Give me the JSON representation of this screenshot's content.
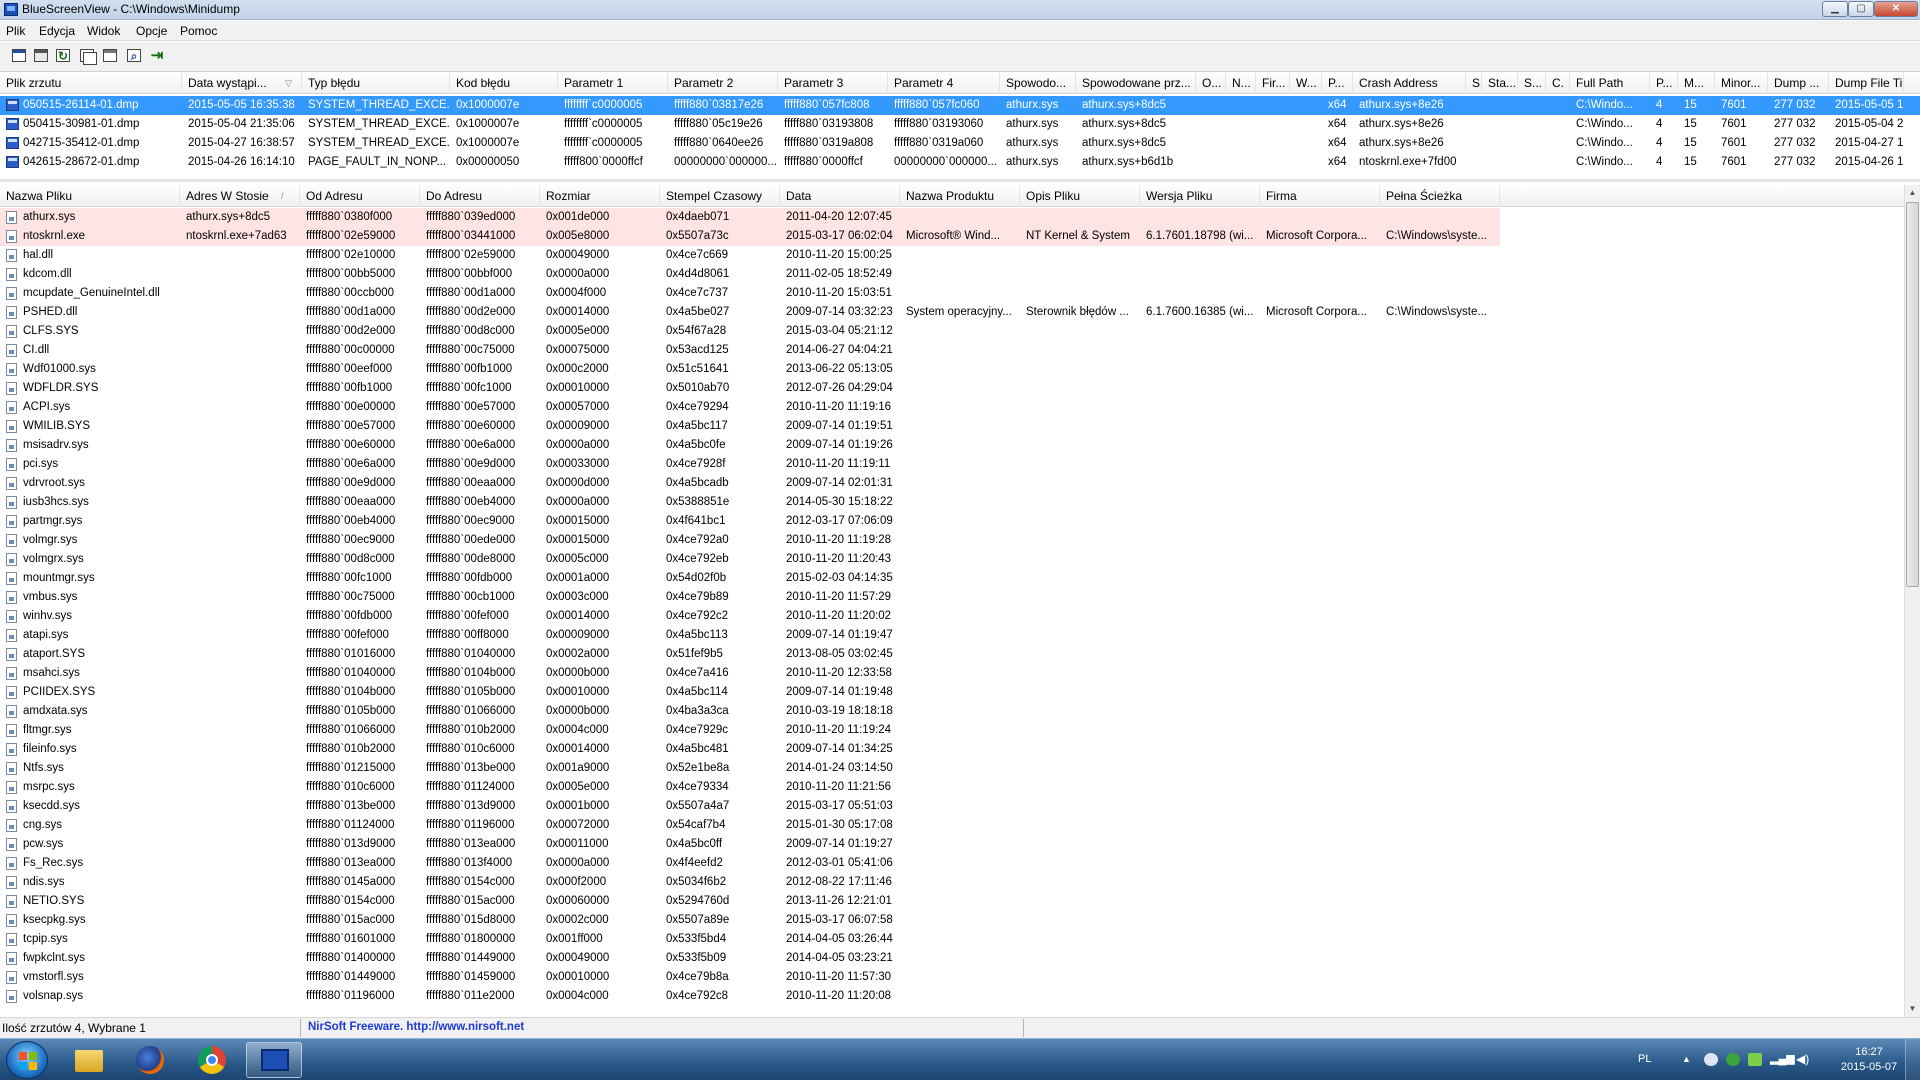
{
  "window": {
    "title": "BlueScreenView - C:\\Windows\\Minidump",
    "min_symbol": "▁",
    "max_symbol": "▢",
    "close_symbol": "✕"
  },
  "menu": [
    "Plik",
    "Edycja",
    "Widok",
    "Opcje",
    "Pomoc"
  ],
  "toolbar_icons": [
    "properties-icon",
    "save-icon",
    "refresh-icon",
    "copy-icon",
    "html-report-icon",
    "find-icon",
    "exit-icon"
  ],
  "top_list": {
    "headers": [
      "Plik zrzutu",
      "Data wystąpi...",
      "Typ błędu",
      "Kod błędu",
      "Parametr 1",
      "Parametr 2",
      "Parametr 3",
      "Parametr 4",
      "Spowodo...",
      "Spowodowane prz...",
      "O...",
      "N...",
      "Fir...",
      "W...",
      "P...",
      "Crash Address",
      "S",
      "Sta...",
      "S...",
      "C.",
      "Full Path",
      "P...",
      "M...",
      "Minor...",
      "Dump ...",
      "Dump File Ti..."
    ],
    "rows": [
      {
        "selected": true,
        "cells": [
          "050515-26114-01.dmp",
          "2015-05-05 16:35:38",
          "SYSTEM_THREAD_EXCE...",
          "0x1000007e",
          "ffffffff`c0000005",
          "fffff880`03817e26",
          "fffff880`057fc808",
          "fffff880`057fc060",
          "athurx.sys",
          "athurx.sys+8dc5",
          "",
          "",
          "",
          "",
          "x64",
          "athurx.sys+8e26",
          "",
          "",
          "",
          "",
          "C:\\Windo...",
          "4",
          "15",
          "7601",
          "277 032",
          "2015-05-05 1..."
        ]
      },
      {
        "selected": false,
        "cells": [
          "050415-30981-01.dmp",
          "2015-05-04 21:35:06",
          "SYSTEM_THREAD_EXCE...",
          "0x1000007e",
          "ffffffff`c0000005",
          "fffff880`05c19e26",
          "fffff880`03193808",
          "fffff880`03193060",
          "athurx.sys",
          "athurx.sys+8dc5",
          "",
          "",
          "",
          "",
          "x64",
          "athurx.sys+8e26",
          "",
          "",
          "",
          "",
          "C:\\Windo...",
          "4",
          "15",
          "7601",
          "277 032",
          "2015-05-04 2..."
        ]
      },
      {
        "selected": false,
        "cells": [
          "042715-35412-01.dmp",
          "2015-04-27 16:38:57",
          "SYSTEM_THREAD_EXCE...",
          "0x1000007e",
          "ffffffff`c0000005",
          "fffff880`0640ee26",
          "fffff880`0319a808",
          "fffff880`0319a060",
          "athurx.sys",
          "athurx.sys+8dc5",
          "",
          "",
          "",
          "",
          "x64",
          "athurx.sys+8e26",
          "",
          "",
          "",
          "",
          "C:\\Windo...",
          "4",
          "15",
          "7601",
          "277 032",
          "2015-04-27 1..."
        ]
      },
      {
        "selected": false,
        "cells": [
          "042615-28672-01.dmp",
          "2015-04-26 16:14:10",
          "PAGE_FAULT_IN_NONP...",
          "0x00000050",
          "fffff800`0000ffcf",
          "00000000`000000...",
          "fffff880`0000ffcf",
          "00000000`000000...",
          "athurx.sys",
          "athurx.sys+b6d1b",
          "",
          "",
          "",
          "",
          "x64",
          "ntoskrnl.exe+7fd00",
          "",
          "",
          "",
          "",
          "C:\\Windo...",
          "4",
          "15",
          "7601",
          "277 032",
          "2015-04-26 1..."
        ]
      }
    ]
  },
  "bottom_list": {
    "headers": [
      "Nazwa Pliku",
      "Adres W Stosie",
      "Od Adresu",
      "Do Adresu",
      "Rozmiar",
      "Stempel Czasowy",
      "Data",
      "Nazwa Produktu",
      "Opis Pliku",
      "Wersja Pliku",
      "Firma",
      "Pełna Ścieżka"
    ],
    "rows": [
      {
        "hl": true,
        "cells": [
          "athurx.sys",
          "athurx.sys+8dc5",
          "fffff880`0380f000",
          "fffff880`039ed000",
          "0x001de000",
          "0x4daeb071",
          "2011-04-20 12:07:45",
          "",
          "",
          "",
          "",
          ""
        ]
      },
      {
        "hl": true,
        "cells": [
          "ntoskrnl.exe",
          "ntoskrnl.exe+7ad63",
          "fffff800`02e59000",
          "fffff800`03441000",
          "0x005e8000",
          "0x5507a73c",
          "2015-03-17 06:02:04",
          "Microsoft® Wind...",
          "NT Kernel & System",
          "6.1.7601.18798 (wi...",
          "Microsoft Corpora...",
          "C:\\Windows\\syste..."
        ]
      },
      {
        "hl": false,
        "cells": [
          "hal.dll",
          "",
          "fffff800`02e10000",
          "fffff800`02e59000",
          "0x00049000",
          "0x4ce7c669",
          "2010-11-20 15:00:25",
          "",
          "",
          "",
          "",
          ""
        ]
      },
      {
        "hl": false,
        "cells": [
          "kdcom.dll",
          "",
          "fffff800`00bb5000",
          "fffff800`00bbf000",
          "0x0000a000",
          "0x4d4d8061",
          "2011-02-05 18:52:49",
          "",
          "",
          "",
          "",
          ""
        ]
      },
      {
        "hl": false,
        "cells": [
          "mcupdate_GenuineIntel.dll",
          "",
          "fffff880`00ccb000",
          "fffff880`00d1a000",
          "0x0004f000",
          "0x4ce7c737",
          "2010-11-20 15:03:51",
          "",
          "",
          "",
          "",
          ""
        ]
      },
      {
        "hl": false,
        "cells": [
          "PSHED.dll",
          "",
          "fffff880`00d1a000",
          "fffff880`00d2e000",
          "0x00014000",
          "0x4a5be027",
          "2009-07-14 03:32:23",
          "System operacyjny...",
          "Sterownik błędów ...",
          "6.1.7600.16385 (wi...",
          "Microsoft Corpora...",
          "C:\\Windows\\syste..."
        ]
      },
      {
        "hl": false,
        "cells": [
          "CLFS.SYS",
          "",
          "fffff880`00d2e000",
          "fffff880`00d8c000",
          "0x0005e000",
          "0x54f67a28",
          "2015-03-04 05:21:12",
          "",
          "",
          "",
          "",
          ""
        ]
      },
      {
        "hl": false,
        "cells": [
          "CI.dll",
          "",
          "fffff880`00c00000",
          "fffff880`00c75000",
          "0x00075000",
          "0x53acd125",
          "2014-06-27 04:04:21",
          "",
          "",
          "",
          "",
          ""
        ]
      },
      {
        "hl": false,
        "cells": [
          "Wdf01000.sys",
          "",
          "fffff880`00eef000",
          "fffff880`00fb1000",
          "0x000c2000",
          "0x51c51641",
          "2013-06-22 05:13:05",
          "",
          "",
          "",
          "",
          ""
        ]
      },
      {
        "hl": false,
        "cells": [
          "WDFLDR.SYS",
          "",
          "fffff880`00fb1000",
          "fffff880`00fc1000",
          "0x00010000",
          "0x5010ab70",
          "2012-07-26 04:29:04",
          "",
          "",
          "",
          "",
          ""
        ]
      },
      {
        "hl": false,
        "cells": [
          "ACPI.sys",
          "",
          "fffff880`00e00000",
          "fffff880`00e57000",
          "0x00057000",
          "0x4ce79294",
          "2010-11-20 11:19:16",
          "",
          "",
          "",
          "",
          ""
        ]
      },
      {
        "hl": false,
        "cells": [
          "WMILIB.SYS",
          "",
          "fffff880`00e57000",
          "fffff880`00e60000",
          "0x00009000",
          "0x4a5bc117",
          "2009-07-14 01:19:51",
          "",
          "",
          "",
          "",
          ""
        ]
      },
      {
        "hl": false,
        "cells": [
          "msisadrv.sys",
          "",
          "fffff880`00e60000",
          "fffff880`00e6a000",
          "0x0000a000",
          "0x4a5bc0fe",
          "2009-07-14 01:19:26",
          "",
          "",
          "",
          "",
          ""
        ]
      },
      {
        "hl": false,
        "cells": [
          "pci.sys",
          "",
          "fffff880`00e6a000",
          "fffff880`00e9d000",
          "0x00033000",
          "0x4ce7928f",
          "2010-11-20 11:19:11",
          "",
          "",
          "",
          "",
          ""
        ]
      },
      {
        "hl": false,
        "cells": [
          "vdrvroot.sys",
          "",
          "fffff880`00e9d000",
          "fffff880`00eaa000",
          "0x0000d000",
          "0x4a5bcadb",
          "2009-07-14 02:01:31",
          "",
          "",
          "",
          "",
          ""
        ]
      },
      {
        "hl": false,
        "cells": [
          "iusb3hcs.sys",
          "",
          "fffff880`00eaa000",
          "fffff880`00eb4000",
          "0x0000a000",
          "0x5388851e",
          "2014-05-30 15:18:22",
          "",
          "",
          "",
          "",
          ""
        ]
      },
      {
        "hl": false,
        "cells": [
          "partmgr.sys",
          "",
          "fffff880`00eb4000",
          "fffff880`00ec9000",
          "0x00015000",
          "0x4f641bc1",
          "2012-03-17 07:06:09",
          "",
          "",
          "",
          "",
          ""
        ]
      },
      {
        "hl": false,
        "cells": [
          "volmgr.sys",
          "",
          "fffff880`00ec9000",
          "fffff880`00ede000",
          "0x00015000",
          "0x4ce792a0",
          "2010-11-20 11:19:28",
          "",
          "",
          "",
          "",
          ""
        ]
      },
      {
        "hl": false,
        "cells": [
          "volmgrx.sys",
          "",
          "fffff880`00d8c000",
          "fffff880`00de8000",
          "0x0005c000",
          "0x4ce792eb",
          "2010-11-20 11:20:43",
          "",
          "",
          "",
          "",
          ""
        ]
      },
      {
        "hl": false,
        "cells": [
          "mountmgr.sys",
          "",
          "fffff880`00fc1000",
          "fffff880`00fdb000",
          "0x0001a000",
          "0x54d02f0b",
          "2015-02-03 04:14:35",
          "",
          "",
          "",
          "",
          ""
        ]
      },
      {
        "hl": false,
        "cells": [
          "vmbus.sys",
          "",
          "fffff880`00c75000",
          "fffff880`00cb1000",
          "0x0003c000",
          "0x4ce79b89",
          "2010-11-20 11:57:29",
          "",
          "",
          "",
          "",
          ""
        ]
      },
      {
        "hl": false,
        "cells": [
          "winhv.sys",
          "",
          "fffff880`00fdb000",
          "fffff880`00fef000",
          "0x00014000",
          "0x4ce792c2",
          "2010-11-20 11:20:02",
          "",
          "",
          "",
          "",
          ""
        ]
      },
      {
        "hl": false,
        "cells": [
          "atapi.sys",
          "",
          "fffff880`00fef000",
          "fffff880`00ff8000",
          "0x00009000",
          "0x4a5bc113",
          "2009-07-14 01:19:47",
          "",
          "",
          "",
          "",
          ""
        ]
      },
      {
        "hl": false,
        "cells": [
          "ataport.SYS",
          "",
          "fffff880`01016000",
          "fffff880`01040000",
          "0x0002a000",
          "0x51fef9b5",
          "2013-08-05 03:02:45",
          "",
          "",
          "",
          "",
          ""
        ]
      },
      {
        "hl": false,
        "cells": [
          "msahci.sys",
          "",
          "fffff880`01040000",
          "fffff880`0104b000",
          "0x0000b000",
          "0x4ce7a416",
          "2010-11-20 12:33:58",
          "",
          "",
          "",
          "",
          ""
        ]
      },
      {
        "hl": false,
        "cells": [
          "PCIIDEX.SYS",
          "",
          "fffff880`0104b000",
          "fffff880`0105b000",
          "0x00010000",
          "0x4a5bc114",
          "2009-07-14 01:19:48",
          "",
          "",
          "",
          "",
          ""
        ]
      },
      {
        "hl": false,
        "cells": [
          "amdxata.sys",
          "",
          "fffff880`0105b000",
          "fffff880`01066000",
          "0x0000b000",
          "0x4ba3a3ca",
          "2010-03-19 18:18:18",
          "",
          "",
          "",
          "",
          ""
        ]
      },
      {
        "hl": false,
        "cells": [
          "fltmgr.sys",
          "",
          "fffff880`01066000",
          "fffff880`010b2000",
          "0x0004c000",
          "0x4ce7929c",
          "2010-11-20 11:19:24",
          "",
          "",
          "",
          "",
          ""
        ]
      },
      {
        "hl": false,
        "cells": [
          "fileinfo.sys",
          "",
          "fffff880`010b2000",
          "fffff880`010c6000",
          "0x00014000",
          "0x4a5bc481",
          "2009-07-14 01:34:25",
          "",
          "",
          "",
          "",
          ""
        ]
      },
      {
        "hl": false,
        "cells": [
          "Ntfs.sys",
          "",
          "fffff880`01215000",
          "fffff880`013be000",
          "0x001a9000",
          "0x52e1be8a",
          "2014-01-24 03:14:50",
          "",
          "",
          "",
          "",
          ""
        ]
      },
      {
        "hl": false,
        "cells": [
          "msrpc.sys",
          "",
          "fffff880`010c6000",
          "fffff880`01124000",
          "0x0005e000",
          "0x4ce79334",
          "2010-11-20 11:21:56",
          "",
          "",
          "",
          "",
          ""
        ]
      },
      {
        "hl": false,
        "cells": [
          "ksecdd.sys",
          "",
          "fffff880`013be000",
          "fffff880`013d9000",
          "0x0001b000",
          "0x5507a4a7",
          "2015-03-17 05:51:03",
          "",
          "",
          "",
          "",
          ""
        ]
      },
      {
        "hl": false,
        "cells": [
          "cng.sys",
          "",
          "fffff880`01124000",
          "fffff880`01196000",
          "0x00072000",
          "0x54caf7b4",
          "2015-01-30 05:17:08",
          "",
          "",
          "",
          "",
          ""
        ]
      },
      {
        "hl": false,
        "cells": [
          "pcw.sys",
          "",
          "fffff880`013d9000",
          "fffff880`013ea000",
          "0x00011000",
          "0x4a5bc0ff",
          "2009-07-14 01:19:27",
          "",
          "",
          "",
          "",
          ""
        ]
      },
      {
        "hl": false,
        "cells": [
          "Fs_Rec.sys",
          "",
          "fffff880`013ea000",
          "fffff880`013f4000",
          "0x0000a000",
          "0x4f4eefd2",
          "2012-03-01 05:41:06",
          "",
          "",
          "",
          "",
          ""
        ]
      },
      {
        "hl": false,
        "cells": [
          "ndis.sys",
          "",
          "fffff880`0145a000",
          "fffff880`0154c000",
          "0x000f2000",
          "0x5034f6b2",
          "2012-08-22 17:11:46",
          "",
          "",
          "",
          "",
          ""
        ]
      },
      {
        "hl": false,
        "cells": [
          "NETIO.SYS",
          "",
          "fffff880`0154c000",
          "fffff880`015ac000",
          "0x00060000",
          "0x5294760d",
          "2013-11-26 12:21:01",
          "",
          "",
          "",
          "",
          ""
        ]
      },
      {
        "hl": false,
        "cells": [
          "ksecpkg.sys",
          "",
          "fffff880`015ac000",
          "fffff880`015d8000",
          "0x0002c000",
          "0x5507a89e",
          "2015-03-17 06:07:58",
          "",
          "",
          "",
          "",
          ""
        ]
      },
      {
        "hl": false,
        "cells": [
          "tcpip.sys",
          "",
          "fffff880`01601000",
          "fffff880`01800000",
          "0x001ff000",
          "0x533f5bd4",
          "2014-04-05 03:26:44",
          "",
          "",
          "",
          "",
          ""
        ]
      },
      {
        "hl": false,
        "cells": [
          "fwpkclnt.sys",
          "",
          "fffff880`01400000",
          "fffff880`01449000",
          "0x00049000",
          "0x533f5b09",
          "2014-04-05 03:23:21",
          "",
          "",
          "",
          "",
          ""
        ]
      },
      {
        "hl": false,
        "cells": [
          "vmstorfl.sys",
          "",
          "fffff880`01449000",
          "fffff880`01459000",
          "0x00010000",
          "0x4ce79b8a",
          "2010-11-20 11:57:30",
          "",
          "",
          "",
          "",
          ""
        ]
      },
      {
        "hl": false,
        "cells": [
          "volsnap.sys",
          "",
          "fffff880`01196000",
          "fffff880`011e2000",
          "0x0004c000",
          "0x4ce792c8",
          "2010-11-20 11:20:08",
          "",
          "",
          "",
          "",
          ""
        ]
      }
    ]
  },
  "status": {
    "summary": "Ilość zrzutów 4, Wybrane 1",
    "credit": "NirSoft Freeware.  http://www.nirsoft.net"
  },
  "taskbar": {
    "apps": [
      "windows-explorer-icon",
      "firefox-icon",
      "chrome-icon",
      "bluescreenview-icon"
    ],
    "language": "PL",
    "time": "16:27",
    "date": "2015-05-07"
  }
}
